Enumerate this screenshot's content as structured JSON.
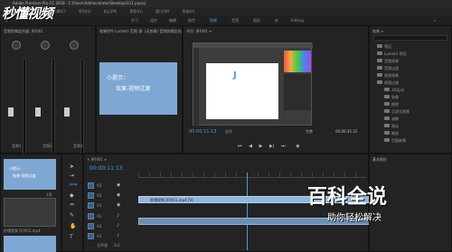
{
  "app": {
    "title": "Adobe Premiere Pro CC 2018 - C:\\Users\\Administrator\\Desktop\\111.prproj"
  },
  "menu": [
    "文件(F)",
    "编辑(E)",
    "剪辑(C)",
    "序列(S)",
    "标记(M)",
    "图形(G)",
    "窗口(W)",
    "帮助(H)"
  ],
  "workspaces": [
    "学习",
    "组件",
    "编辑",
    "颜色",
    "效果",
    "音频",
    "图形",
    "库",
    "Editing"
  ],
  "workspace_active": "效果",
  "logo": {
    "text": "秒懂视频"
  },
  "audio_mixer": {
    "title": "音频剪辑混合器: 序列01",
    "tracks": [
      "音频1",
      "音频2",
      "音频3"
    ]
  },
  "source_monitor": {
    "title": "效果控件  Lumetri 范围  源: (无剪辑)  音频剪辑混合器",
    "tip_line1": "小提示：",
    "tip_line2": "效果-视频过渡"
  },
  "program_monitor": {
    "title": "节目: 序列01 ≡",
    "timecode_left": "00:00:11:13",
    "zoom": "适合",
    "timecode_right": "00:00:35:22",
    "fit_label": "完整"
  },
  "effects_panel": {
    "title": "效果 ≡",
    "tree": [
      "预设",
      "Lumetri 预设",
      "音频效果",
      "音频过渡",
      "视频效果",
      "视频过渡",
      "3D运动",
      "划像",
      "擦除",
      "沉浸式视频",
      "溶解",
      "滑动",
      "缩放",
      "页面剥落"
    ],
    "footer": "基本图形"
  },
  "project_panel": {
    "thumb_line1": "小提示：",
    "thumb_line2": "效果-视频过渡",
    "file_label": "秒懂视频 序列01.mp4",
    "item_count": "1项"
  },
  "timeline": {
    "title": "× 序列01 ≡",
    "timecode": "00:00:11:13",
    "video_tracks": [
      "V3",
      "V2",
      "V1"
    ],
    "audio_tracks": [
      "A1",
      "A2",
      "A3"
    ],
    "clip_v1": "秒懂视频 序列01.mp4 [V]",
    "master": "主声道",
    "master_value": "0.0"
  },
  "watermark": {
    "line1": "百科全说",
    "line2": "助你轻松解决"
  },
  "colors": {
    "accent": "#4d9be6",
    "tip_blue": "#7ea8d3",
    "clip_blue": "#8fb6dc"
  }
}
